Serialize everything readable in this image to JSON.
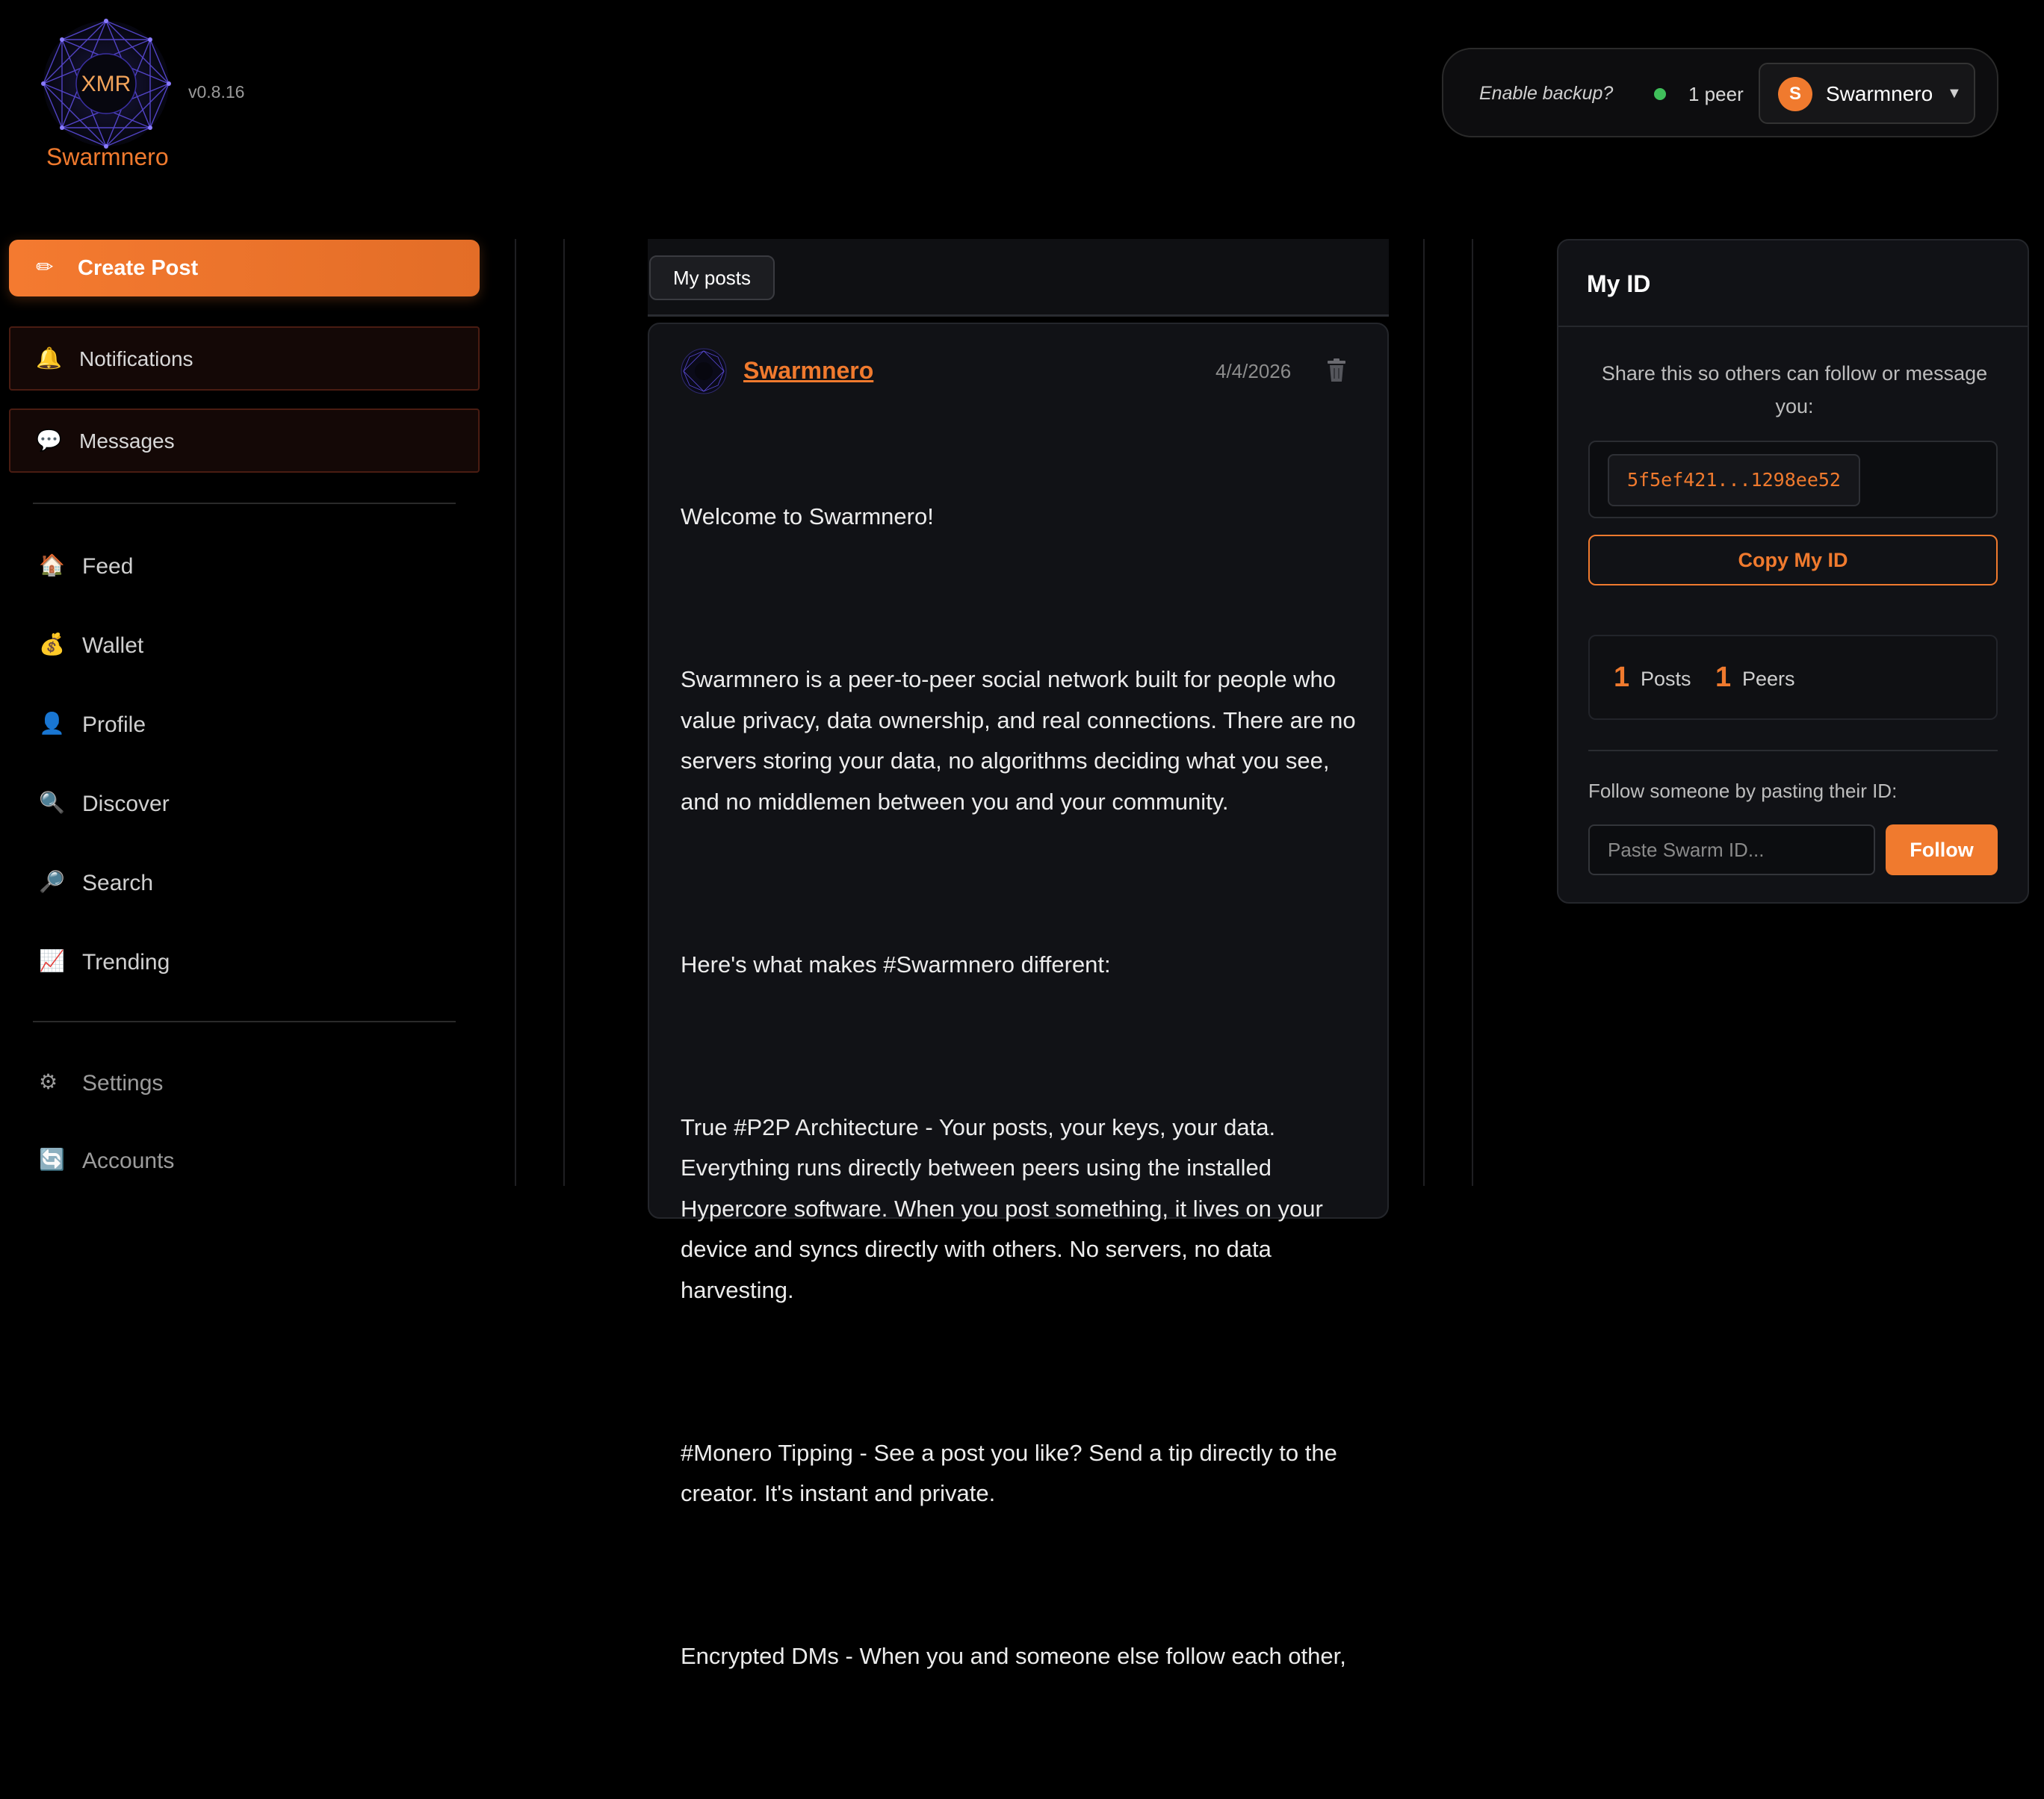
{
  "header": {
    "logo_text": "XMR",
    "app_name": "Swarmnero",
    "version": "v0.8.16",
    "backup_prompt": "Enable backup?",
    "peer_status": "1 peer",
    "account": {
      "initial": "S",
      "name": "Swarmnero",
      "caret": "▼"
    }
  },
  "sidebar": {
    "create_post": {
      "icon": "✏",
      "label": "Create Post"
    },
    "boxed_items": [
      {
        "icon": "🔔",
        "label": "Notifications"
      },
      {
        "icon": "💬",
        "label": "Messages"
      }
    ],
    "nav_items": [
      {
        "icon": "🏠",
        "label": "Feed"
      },
      {
        "icon": "💰",
        "label": "Wallet"
      },
      {
        "icon": "👤",
        "label": "Profile"
      },
      {
        "icon": "🔍",
        "label": "Discover"
      },
      {
        "icon": "🔎",
        "label": "Search"
      },
      {
        "icon": "📈",
        "label": "Trending"
      }
    ],
    "bottom_items": [
      {
        "icon": "⚙",
        "label": "Settings"
      },
      {
        "icon": "🔄",
        "label": "Accounts"
      }
    ]
  },
  "feed": {
    "tab_label": "My posts",
    "post": {
      "author": "Swarmnero",
      "date": "4/4/2026",
      "paragraphs": [
        "Welcome to Swarmnero!",
        "Swarmnero is a peer-to-peer social network built for people who value privacy, data ownership, and real connections. There are no servers storing your data, no algorithms deciding what you see, and no middlemen between you and your community.",
        "Here's what makes #Swarmnero different:",
        "True #P2P Architecture - Your posts, your keys, your data. Everything runs directly between peers using the installed Hypercore software. When you post something, it lives on your device and syncs directly with others. No servers, no data harvesting.",
        "#Monero Tipping - See a post you like? Send a tip directly to the creator. It's instant and private.",
        "Encrypted DMs - When you and someone else follow each other,"
      ]
    }
  },
  "my_id": {
    "title": "My ID",
    "share_text": "Share this so others can follow or message you:",
    "id_value": "5f5ef421...1298ee52",
    "copy_label": "Copy My ID",
    "stats": {
      "posts_count": "1",
      "posts_label": "Posts",
      "peers_count": "1",
      "peers_label": "Peers"
    },
    "follow_label": "Follow someone by pasting their ID:",
    "follow_placeholder": "Paste Swarm ID...",
    "follow_button": "Follow"
  },
  "colors": {
    "accent": "#f07a2e",
    "online": "#3fbf5a",
    "background": "#000000"
  }
}
